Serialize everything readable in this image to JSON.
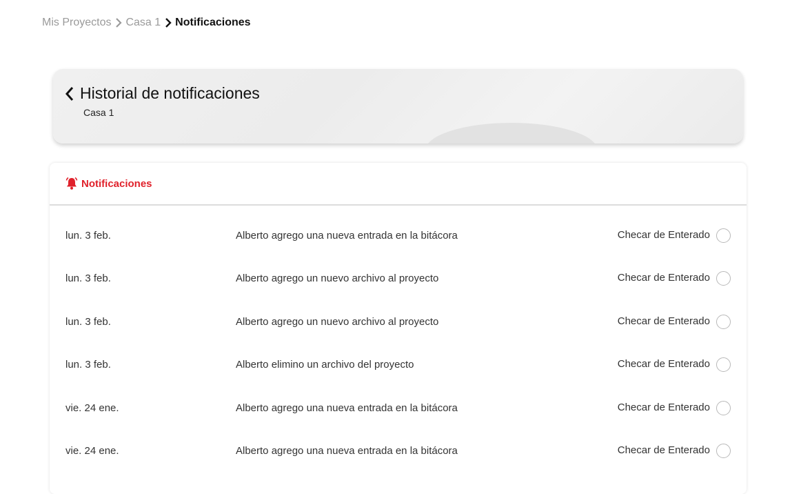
{
  "breadcrumb": {
    "items": [
      "Mis Proyectos",
      "Casa 1"
    ],
    "current": "Notificaciones"
  },
  "header": {
    "title": "Historial de notificaciones",
    "subtitle": "Casa 1"
  },
  "notifications": {
    "title": "Notificaciones",
    "accent_color": "#e0212b",
    "ack_label": "Checar de Enterado",
    "rows": [
      {
        "date": "lun. 3 feb.",
        "message": "Alberto agrego una nueva entrada en la bitácora",
        "ack": "Checar de Enterado"
      },
      {
        "date": "lun. 3 feb.",
        "message": "Alberto agrego un nuevo archivo al proyecto",
        "ack": "Checar de Enterado"
      },
      {
        "date": "lun. 3 feb.",
        "message": "Alberto agrego un nuevo archivo al proyecto",
        "ack": "Checar de Enterado"
      },
      {
        "date": "lun. 3 feb.",
        "message": "Alberto elimino un archivo del proyecto",
        "ack": "Checar de Enterado"
      },
      {
        "date": "vie. 24 ene.",
        "message": "Alberto agrego una nueva entrada en la bitácora",
        "ack": "Checar de Enterado"
      },
      {
        "date": "vie. 24 ene.",
        "message": "Alberto agrego una nueva entrada en la bitácora",
        "ack": "Checar de Enterado"
      }
    ]
  },
  "icons": {
    "back": "chevron-left-icon",
    "separator": "chevron-right-icon",
    "bell": "bell-icon",
    "check": "circle-checkbox-icon"
  }
}
